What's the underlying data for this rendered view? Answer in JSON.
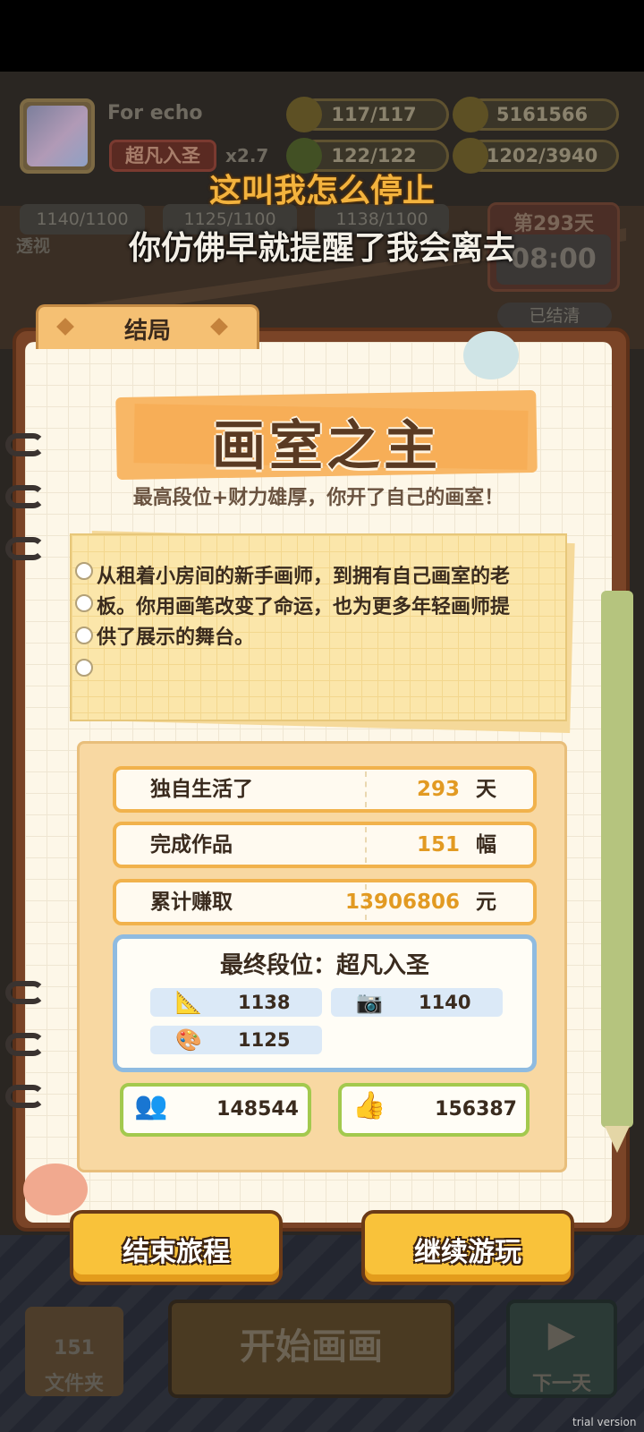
{
  "hud": {
    "player_name": "For echo",
    "rank_label": "超凡入圣",
    "multiplier": "x2.7",
    "energy": "117/117",
    "health": "122/122",
    "coins": "5161566",
    "inspiration": "1202/3940",
    "stat_a": "1140/1100",
    "stat_b": "1125/1100",
    "stat_c": "1138/1100",
    "perspective_label": "透视",
    "day_label": "第293天",
    "clock": "08:00",
    "settled_label": "已结清"
  },
  "subtitles": {
    "line1": "这叫我怎么停止",
    "line2": "你仿佛早就提醒了我会离去"
  },
  "ending": {
    "tab_label": "结局",
    "title": "画室之主",
    "subtitle": "最高段位+财力雄厚，你开了自己的画室！",
    "story_lines": [
      "从租着小房间的新手画师，到拥有自己画室的老",
      "板。你用画笔改变了命运，也为更多年轻画师提",
      "供了展示的舞台。"
    ]
  },
  "stats": [
    {
      "label": "独自生活了",
      "value": "293",
      "unit": "天"
    },
    {
      "label": "完成作品",
      "value": "151",
      "unit": "幅"
    },
    {
      "label": "累计赚取",
      "value": "13906806",
      "unit": "元"
    }
  ],
  "final_rank": {
    "title": "最终段位：超凡入圣",
    "skills": [
      {
        "icon": "ruler-icon",
        "value": "1138"
      },
      {
        "icon": "camera-icon",
        "value": "1140"
      },
      {
        "icon": "palette-icon",
        "value": "1125"
      }
    ]
  },
  "social": {
    "fans": "148544",
    "likes": "156387"
  },
  "buttons": {
    "end": "结束旅程",
    "continue": "继续游玩"
  },
  "bottom_hud": {
    "folder_count": "151",
    "folder_label": "文件夹",
    "start_label": "开始画画",
    "next_day_label": "下一天",
    "watermark": "trial version"
  },
  "colors": {
    "accent_orange": "#f9c23a",
    "value_orange": "#e29a22",
    "rank_blue": "#8fbbe0",
    "social_green": "#a3c94e"
  }
}
